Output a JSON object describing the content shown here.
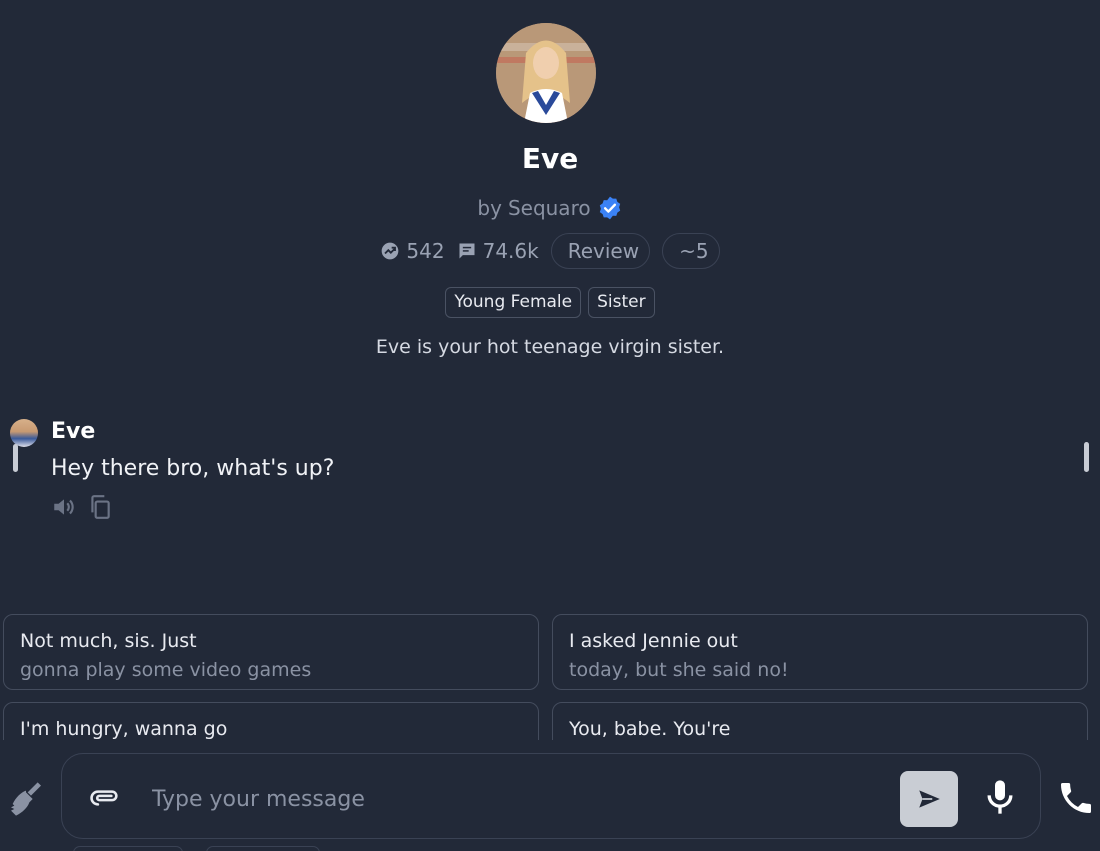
{
  "character": {
    "name": "Eve",
    "creator_prefix": "by",
    "creator": "Sequaro",
    "interactions": "542",
    "messages": "74.6k",
    "review_label": "Review",
    "tokens": "~5",
    "tags": [
      "Young Female",
      "Sister"
    ],
    "description": "Eve is your hot teenage virgin sister."
  },
  "chat": {
    "messages": [
      {
        "sender": "Eve",
        "text": "Hey there bro, what's up?"
      }
    ]
  },
  "suggestions": [
    {
      "line1": "Not much, sis. Just",
      "line2": "gonna play some video games"
    },
    {
      "line1": "I asked Jennie out",
      "line2": "today, but she said no!"
    },
    {
      "line1": "I'm hungry, wanna go",
      "line2": ""
    },
    {
      "line1": "You, babe. You're",
      "line2": ""
    }
  ],
  "composer": {
    "placeholder": "Type your message"
  },
  "colors": {
    "background": "#222938",
    "verified": "#3b82f6",
    "send_button": "#c9cdd4"
  }
}
